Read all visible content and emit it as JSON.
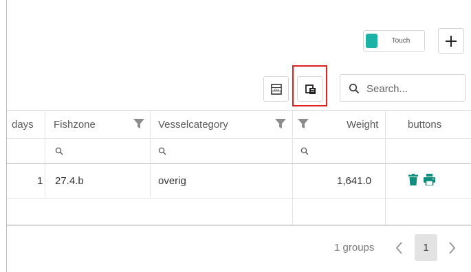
{
  "toolbar": {
    "touch_label": "Touch",
    "touch_color": "#1ab3a6",
    "add_icon": "plus-icon",
    "xlsx_icon": "xlsx-export-icon",
    "chooser_icon": "column-chooser-icon",
    "search_placeholder": "Search..."
  },
  "grid": {
    "columns": [
      {
        "label": "days"
      },
      {
        "label": "Fishzone"
      },
      {
        "label": "Vesselcategory"
      },
      {
        "label": "Weight"
      },
      {
        "label": "buttons"
      }
    ],
    "rows": [
      {
        "days": "1",
        "fishzone": "27.4.b",
        "vesselcategory": "overig",
        "weight": "1,641.0"
      }
    ],
    "action_color": "#0f8c7d"
  },
  "footer": {
    "groups_text": "1 groups",
    "current_page": "1"
  },
  "highlight_color": "#e0201f"
}
